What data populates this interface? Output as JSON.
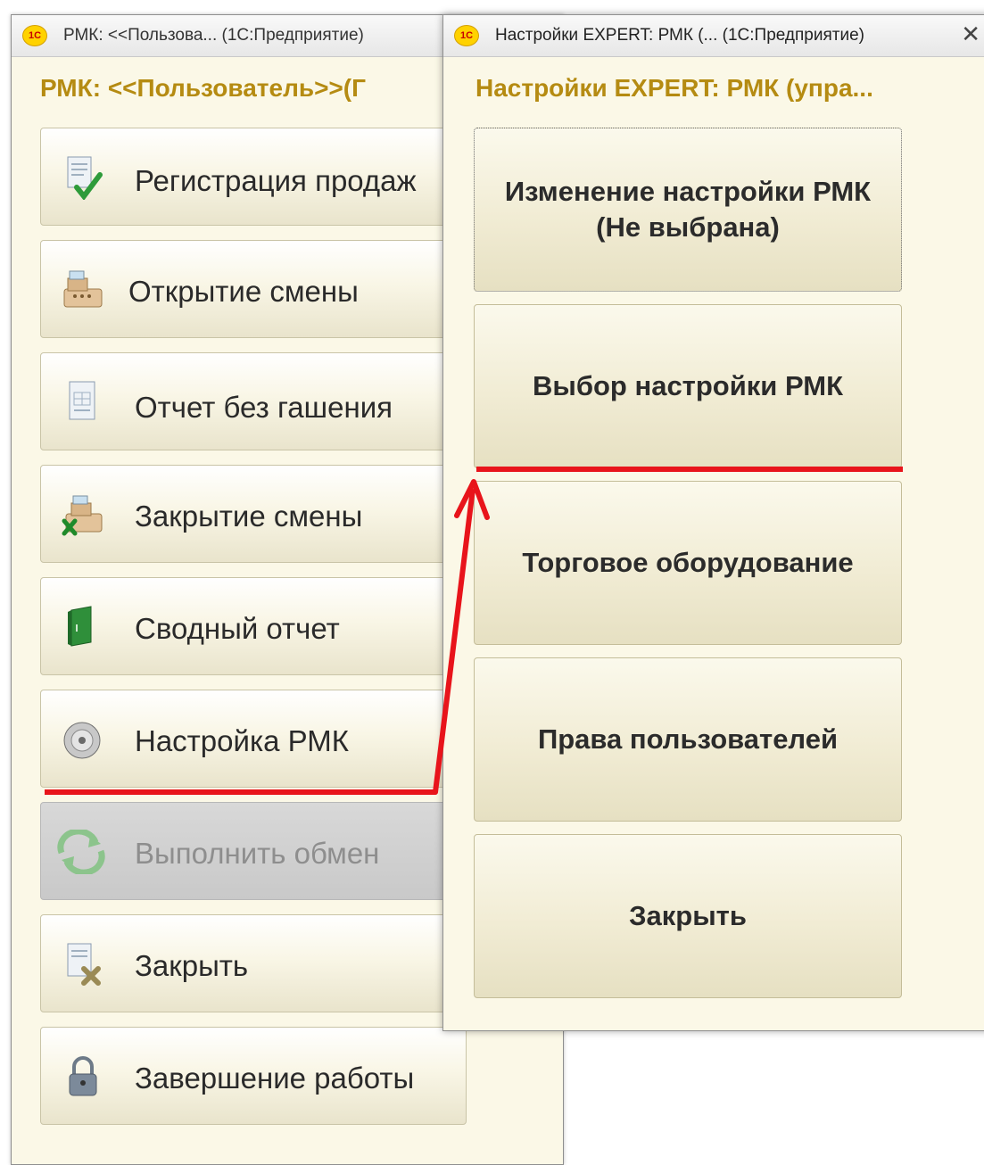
{
  "window_left": {
    "title": "РМК: <<Пользова...  (1С:Предприятие)",
    "form_title": "РМК: <<Пользователь>>(Г",
    "buttons": [
      {
        "label": "Регистрация продаж",
        "icon": "sales-register-icon"
      },
      {
        "label": "Открытие смены",
        "icon": "cash-register-icon"
      },
      {
        "label": "Отчет без гашения",
        "icon": "report-icon"
      },
      {
        "label": "Закрытие смены",
        "icon": "cash-register-close-icon"
      },
      {
        "label": "Сводный отчет",
        "icon": "book-icon"
      },
      {
        "label": "Настройка РМК",
        "icon": "disc-icon"
      },
      {
        "label": "Выполнить обмен",
        "icon": "sync-icon",
        "disabled": true
      },
      {
        "label": "Закрыть",
        "icon": "close-document-icon"
      },
      {
        "label": "Завершение работы",
        "icon": "lock-icon"
      }
    ]
  },
  "window_right": {
    "title": "Настройки EXPERT: РМК (...  (1С:Предприятие)",
    "close_glyph": "✕",
    "form_title": "Настройки EXPERT: РМК (упра...",
    "buttons": [
      {
        "label_line1": "Изменение настройки РМК",
        "label_line2": "(Не выбрана)"
      },
      {
        "label": "Выбор настройки РМК"
      },
      {
        "label": "Торговое оборудование"
      },
      {
        "label": "Права пользователей"
      },
      {
        "label": "Закрыть"
      }
    ]
  },
  "logo_text": "1С",
  "colors": {
    "form_title": "#b58b12",
    "annotation": "#e8141b",
    "window_bg": "#fbf8e7"
  }
}
